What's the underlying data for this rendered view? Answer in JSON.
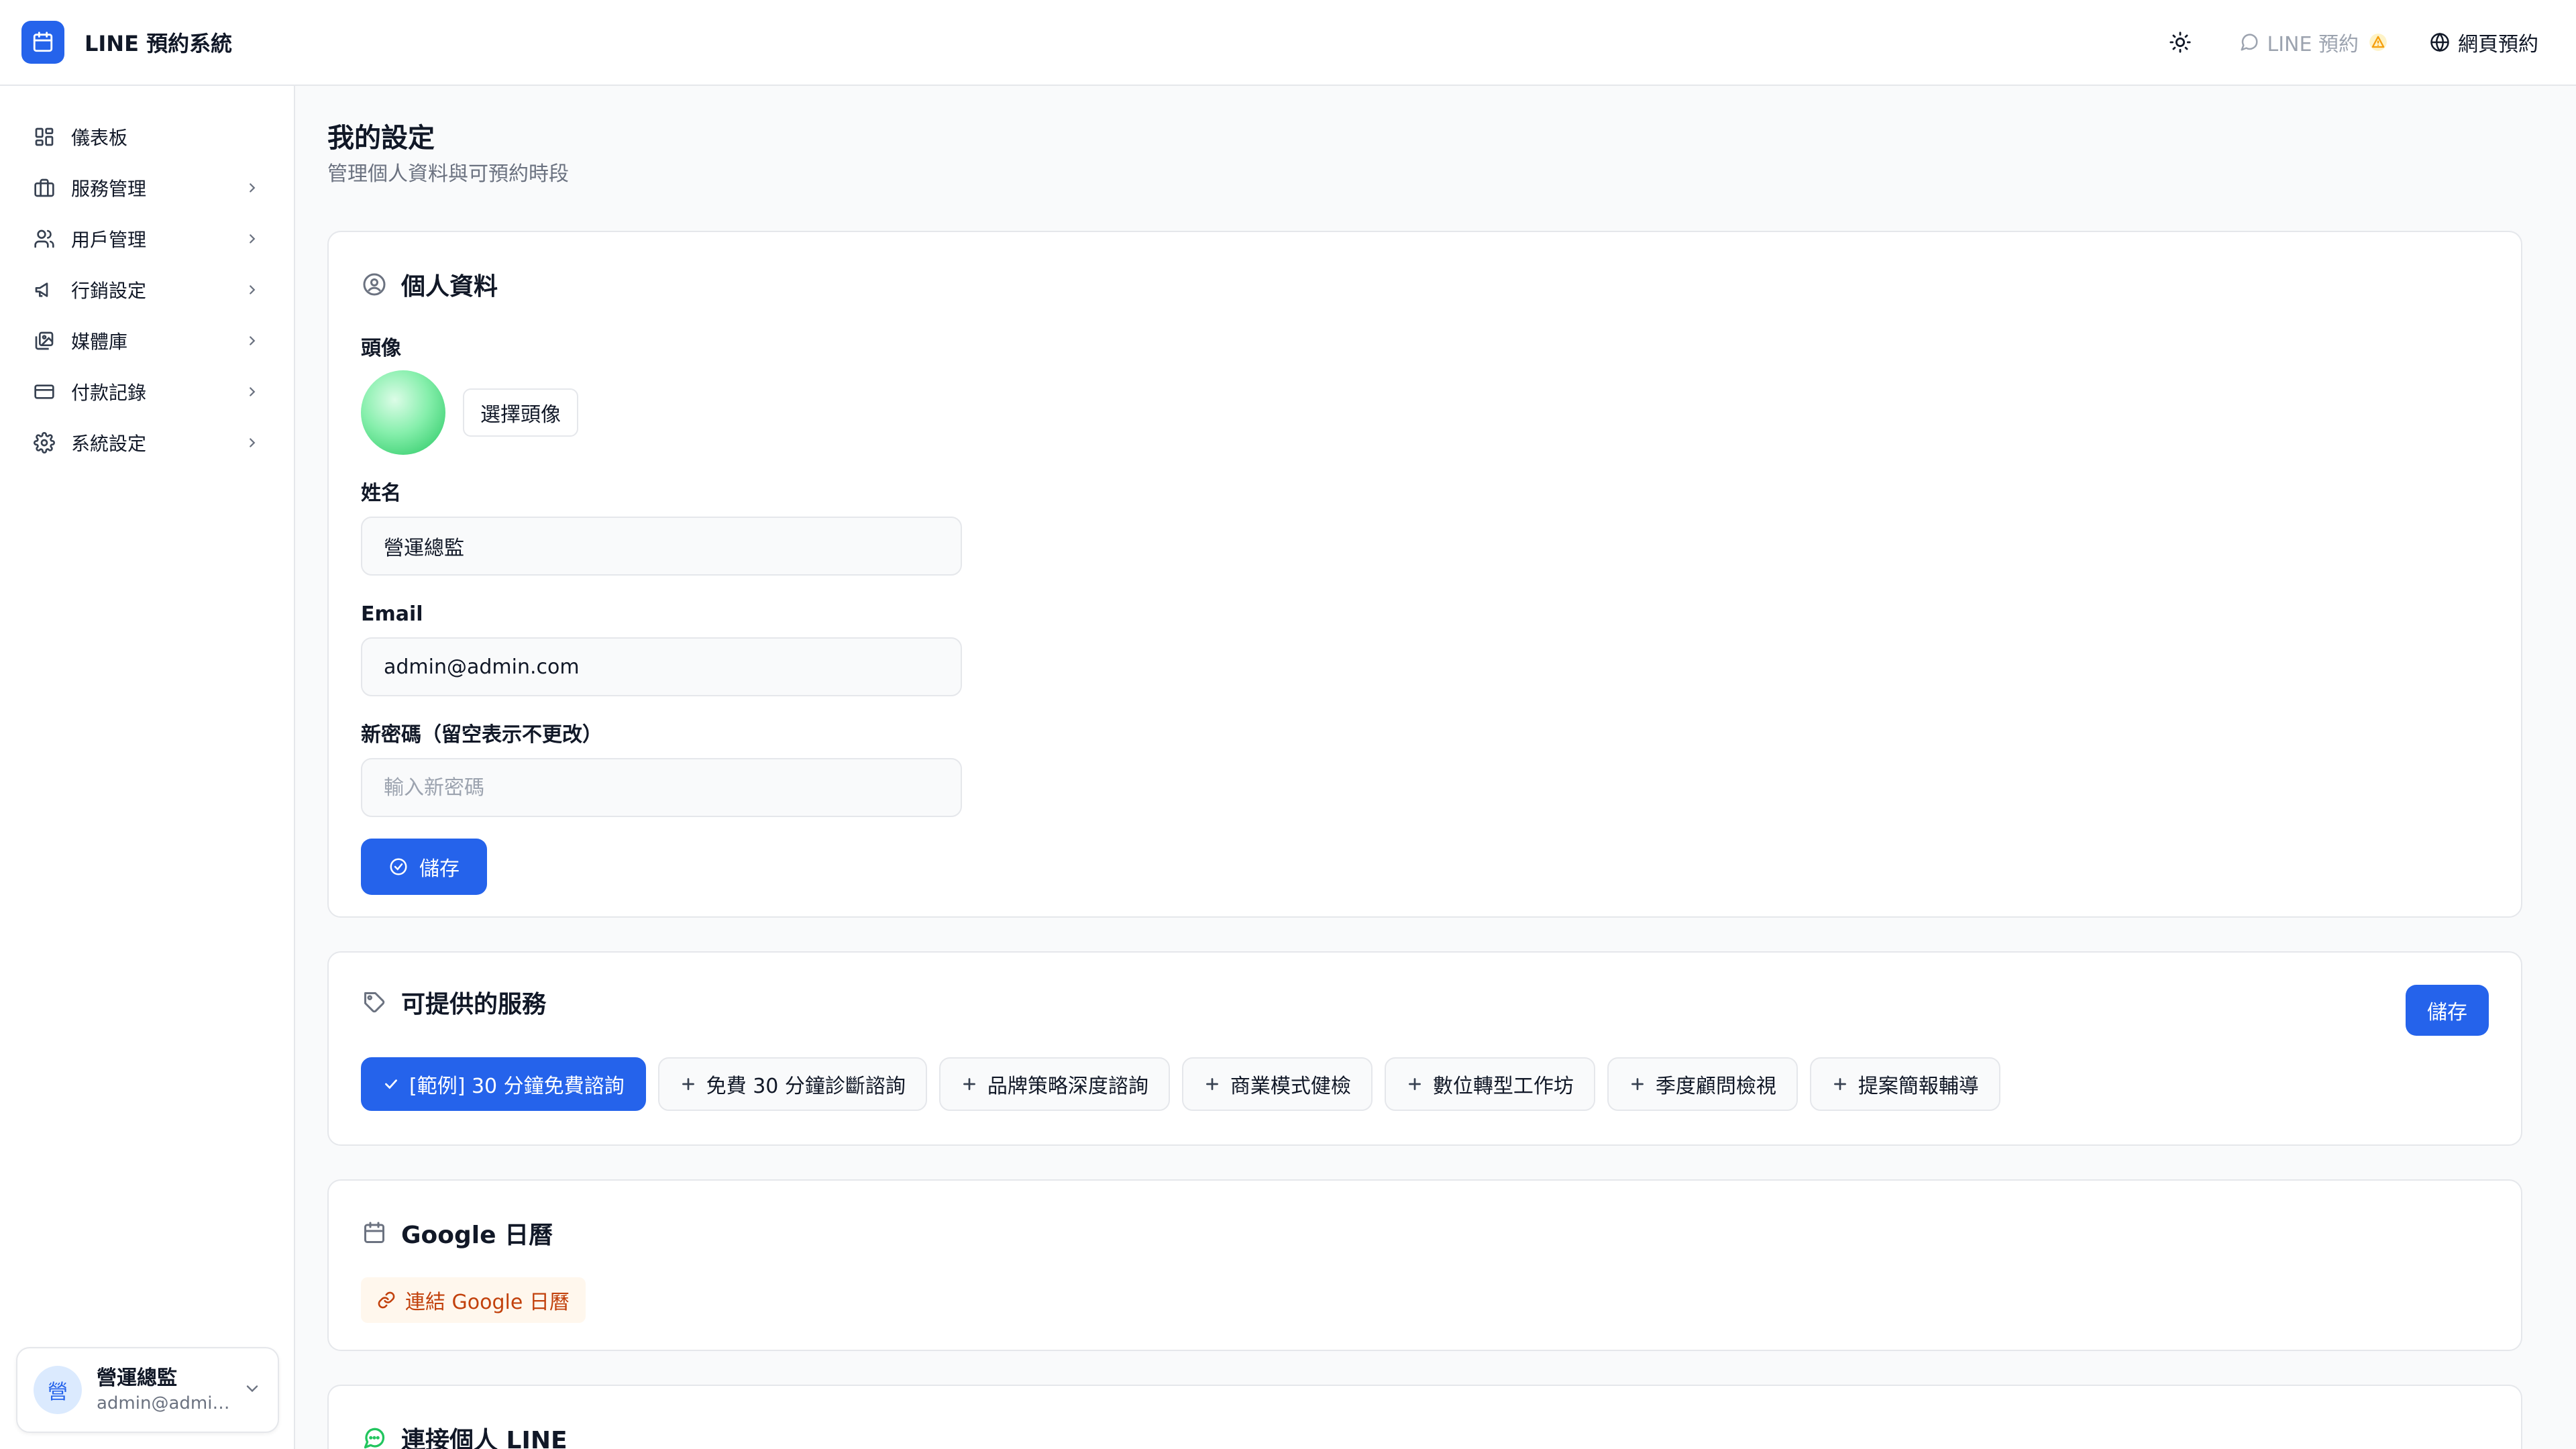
{
  "app": {
    "title": "LINE 預約系統"
  },
  "topbar": {
    "theme_icon": "sun-icon",
    "line_booking_label": "LINE 預約",
    "web_booking_label": "網頁預約"
  },
  "sidebar": {
    "items": [
      {
        "label": "儀表板",
        "icon": "dashboard-icon",
        "chevron": false
      },
      {
        "label": "服務管理",
        "icon": "briefcase-icon",
        "chevron": true
      },
      {
        "label": "用戶管理",
        "icon": "users-icon",
        "chevron": true
      },
      {
        "label": "行銷設定",
        "icon": "megaphone-icon",
        "chevron": true
      },
      {
        "label": "媒體庫",
        "icon": "images-icon",
        "chevron": true
      },
      {
        "label": "付款記錄",
        "icon": "credit-card-icon",
        "chevron": true
      },
      {
        "label": "系統設定",
        "icon": "gear-icon",
        "chevron": true
      }
    ],
    "user": {
      "initial": "營",
      "name": "營運總監",
      "email": "admin@admin...."
    }
  },
  "page": {
    "title": "我的設定",
    "subtitle": "管理個人資料與可預約時段"
  },
  "profile": {
    "title": "個人資料",
    "avatar_label": "頭像",
    "choose_avatar": "選擇頭像",
    "name_label": "姓名",
    "name_value": "營運總監",
    "email_label": "Email",
    "email_value": "admin@admin.com",
    "password_label": "新密碼（留空表示不更改）",
    "password_placeholder": "輸入新密碼",
    "save_label": "儲存"
  },
  "services": {
    "title": "可提供的服務",
    "save_label": "儲存",
    "items": [
      {
        "label": "[範例] 30 分鐘免費諮詢",
        "selected": true
      },
      {
        "label": "免費 30 分鐘診斷諮詢",
        "selected": false
      },
      {
        "label": "品牌策略深度諮詢",
        "selected": false
      },
      {
        "label": "商業模式健檢",
        "selected": false
      },
      {
        "label": "數位轉型工作坊",
        "selected": false
      },
      {
        "label": "季度顧問檢視",
        "selected": false
      },
      {
        "label": "提案簡報輔導",
        "selected": false
      }
    ]
  },
  "google": {
    "title": "Google 日曆",
    "connect_label": "連結 Google 日曆"
  },
  "line": {
    "title": "連接個人 LINE"
  },
  "colors": {
    "accent": "#2563eb",
    "warning": "#f59e0b",
    "orange_text": "#c2410c",
    "line_green": "#22c55e"
  }
}
